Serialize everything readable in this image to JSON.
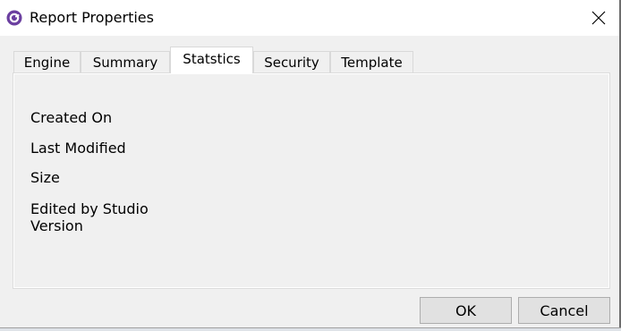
{
  "window": {
    "title": "Report Properties",
    "app_icon": "app-logo-icon",
    "close_icon": "close-icon"
  },
  "tabs": [
    {
      "label": "Engine",
      "active": false
    },
    {
      "label": "Summary",
      "active": false
    },
    {
      "label": "Statstics",
      "active": true
    },
    {
      "label": "Security",
      "active": false
    },
    {
      "label": "Template",
      "active": false
    }
  ],
  "statistics": {
    "created_on": "Created On",
    "last_modified": "Last Modified",
    "size": "Size",
    "edited_by_line1": "Edited by Studio",
    "edited_by_line2": "Version"
  },
  "buttons": {
    "ok": "OK",
    "cancel": "Cancel"
  },
  "colors": {
    "app_icon": "#6b3fa0",
    "dialog_bg": "#f0f0f0",
    "titlebar_bg": "#ffffff",
    "button_bg": "#e1e1e1"
  }
}
